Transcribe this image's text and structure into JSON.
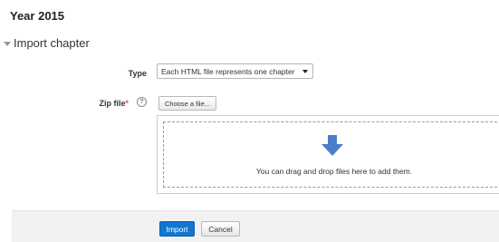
{
  "page": {
    "title": "Year 2015"
  },
  "section": {
    "title": "Import chapter",
    "expanded": true,
    "icon": "caret-down-icon"
  },
  "form": {
    "type_label": "Type",
    "type_value": "Each HTML file represents one chapter",
    "zip_label": "Zip file",
    "zip_required_marker": "*",
    "help_icon_glyph": "?",
    "choose_file_label": "Choose a file...",
    "dropzone_text": "You can drag and drop files here to add them.",
    "dropzone_icon": "arrow-down-icon"
  },
  "actions": {
    "import_label": "Import",
    "cancel_label": "Cancel"
  },
  "colors": {
    "primary_button": "#1177d1",
    "required_marker": "#d9534f",
    "drop_arrow": "#4a7fc9"
  }
}
